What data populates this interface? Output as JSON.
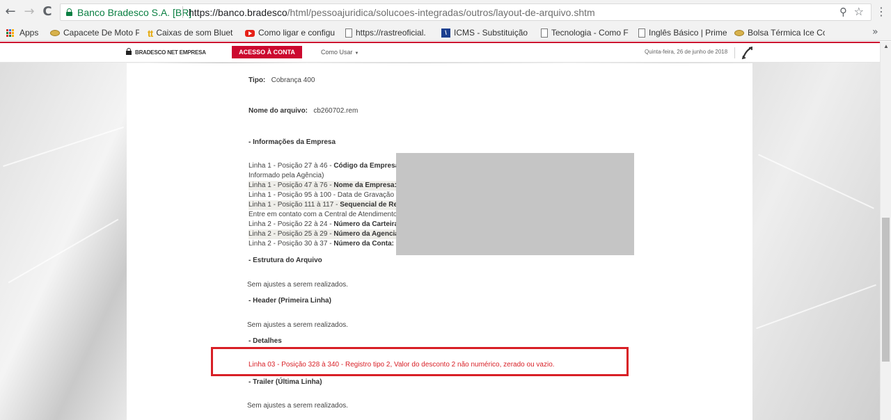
{
  "browser": {
    "nav": {
      "back": "←",
      "forward": "→",
      "reload": "C"
    },
    "site_name": "Banco Bradesco S.A. [BR]",
    "url_host": "https://banco.bradesco",
    "url_path": "/html/pessoajuridica/solucoes-integradas/outros/layout-de-arquivo.shtm",
    "zoom_icon": "⚲",
    "star_icon": "☆",
    "menu_icon": "⋮",
    "bookmarks": [
      "Apps",
      "Capacete De Moto P",
      "Caixas de som Bluet",
      "Como ligar e configu",
      "https://rastreoficial.",
      "ICMS - Substituição",
      "Tecnologia - Como F",
      "Inglês Básico | Prime",
      "Bolsa Térmica Ice Co"
    ],
    "bookmarks_more": "»"
  },
  "site_header": {
    "brand": "BRADESCO NET EMPRESA",
    "access_button": "ACESSO À CONTA",
    "how_to_use": "Como Usar",
    "date": "Quinta-feira, 26 de junho de 2018"
  },
  "content": {
    "tipo_label": "Tipo:",
    "tipo_value": "Cobrança 400",
    "arquivo_label": "Nome do arquivo:",
    "arquivo_value": "cb260702.rem",
    "info_empresa": "- Informações da Empresa",
    "info_lines": [
      {
        "prefix": "Linha 1 - Posição 27 à 46 - ",
        "label": "Código da Empresa"
      },
      {
        "prefix": "Informado pela Agência)",
        "label": ""
      },
      {
        "prefix": "Linha 1 - Posição 47 à 76 - ",
        "label": "Nome da Empresa:"
      },
      {
        "prefix": "Linha 1 - Posição 95 à 100 - Data de Gravação",
        "label": ""
      },
      {
        "prefix": "Linha 1 - Posição 111 à 117 - ",
        "label": "Sequencial de Re"
      },
      {
        "prefix": "Entre em contato com a Central de Atendimento",
        "label": ""
      },
      {
        "prefix": "Linha 2 - Posição 22 à 24 - ",
        "label": "Número da Carteira"
      },
      {
        "prefix": "Linha 2 - Posição 25 à 29 - ",
        "label": "Número da Agencia"
      },
      {
        "prefix": "Linha 2 - Posição 30 à 37 - ",
        "label": "Número da Conta:"
      }
    ],
    "estrutura": "- Estrutura do Arquivo",
    "sem_ajustes_1": "Sem ajustes a serem realizados.",
    "header": "- Header (Primeira Linha)",
    "sem_ajustes_2": "Sem ajustes a serem realizados.",
    "detalhes": "- Detalhes",
    "detalhe_erro": "Linha 03 - Posição 328 à 340 - Registro tipo 2, Valor do desconto 2 não numérico, zerado ou vazio.",
    "trailer": "- Trailer (Última Linha)",
    "sem_ajustes_3": "Sem ajustes a serem realizados."
  },
  "colors": {
    "bradesco_red": "#cc092f",
    "annotation_red": "#d81f26",
    "secure_green": "#0b8043",
    "redaction_grey": "#c5c5c5"
  }
}
